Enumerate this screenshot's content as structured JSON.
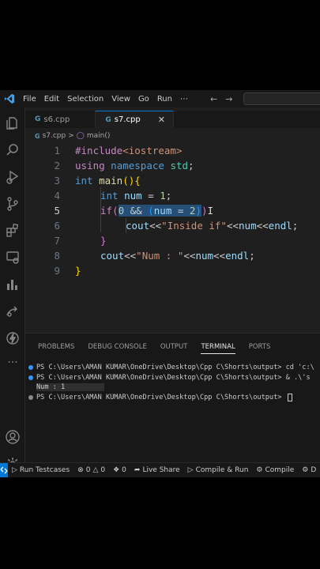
{
  "menu": [
    "File",
    "Edit",
    "Selection",
    "View",
    "Go",
    "Run",
    "⋯"
  ],
  "nav": {
    "back": "←",
    "forward": "→"
  },
  "tabs": [
    {
      "icon": "G",
      "label": "s6.cpp"
    },
    {
      "icon": "G",
      "label": "s7.cpp",
      "close": "✕"
    }
  ],
  "breadcrumb": {
    "file": "s7.cpp",
    "sep": ">",
    "symbol": "main()"
  },
  "editor": {
    "line_numbers": [
      "1",
      "2",
      "3",
      "4",
      "5",
      "6",
      "7",
      "8",
      "9"
    ],
    "lines": {
      "l1": {
        "directive": "#include",
        "header": "<iostream>"
      },
      "l2": {
        "using": "using",
        "namespace": "namespace",
        "std": "std",
        "semi": ";"
      },
      "l3": {
        "int": "int",
        "main": "main",
        "parens": "()",
        "brace": "{"
      },
      "l4": {
        "int": "int",
        "var": "num",
        "eq": " = ",
        "val": "1",
        "semi": ";"
      },
      "l5": {
        "if": "if",
        "open": "(",
        "zero": "0",
        "and": " && ",
        "inner_open": "(",
        "var": "num",
        "eq": " = ",
        "two": "2",
        "inner_close": ")",
        "close": ")"
      },
      "l6": {
        "cout": "cout",
        "op1": "<<",
        "str": "\"Inside if\"",
        "op2": "<<",
        "var": "num",
        "op3": "<<",
        "endl": "endl",
        "semi": ";"
      },
      "l7": {
        "brace": "}"
      },
      "l8": {
        "cout": "cout",
        "op1": "<<",
        "str": "\"Num : \"",
        "op2": "<<",
        "var": "num",
        "op3": "<<",
        "endl": "endl",
        "semi": ";"
      },
      "l9": {
        "brace": "}"
      }
    }
  },
  "panel": {
    "tabs": [
      "PROBLEMS",
      "DEBUG CONSOLE",
      "OUTPUT",
      "TERMINAL",
      "PORTS"
    ],
    "active_tab": "TERMINAL",
    "terminal": [
      "PS C:\\Users\\AMAN KUMAR\\OneDrive\\Desktop\\Cpp C\\Shorts\\output> cd 'c:\\",
      "PS C:\\Users\\AMAN KUMAR\\OneDrive\\Desktop\\Cpp C\\Shorts\\output> & .\\'s",
      "Num : 1",
      "PS C:\\Users\\AMAN KUMAR\\OneDrive\\Desktop\\Cpp C\\Shorts\\output> "
    ]
  },
  "statusbar": {
    "run_testcases": "Run Testcases",
    "errors": "0",
    "warnings": "0",
    "ports": "0",
    "live_share": "Live Share",
    "compile_run": "Compile & Run",
    "compile": "Compile",
    "debug": "D"
  },
  "colors": {
    "accent": "#0078d4",
    "selection": "#264f78",
    "background": "#1f1f1f"
  }
}
